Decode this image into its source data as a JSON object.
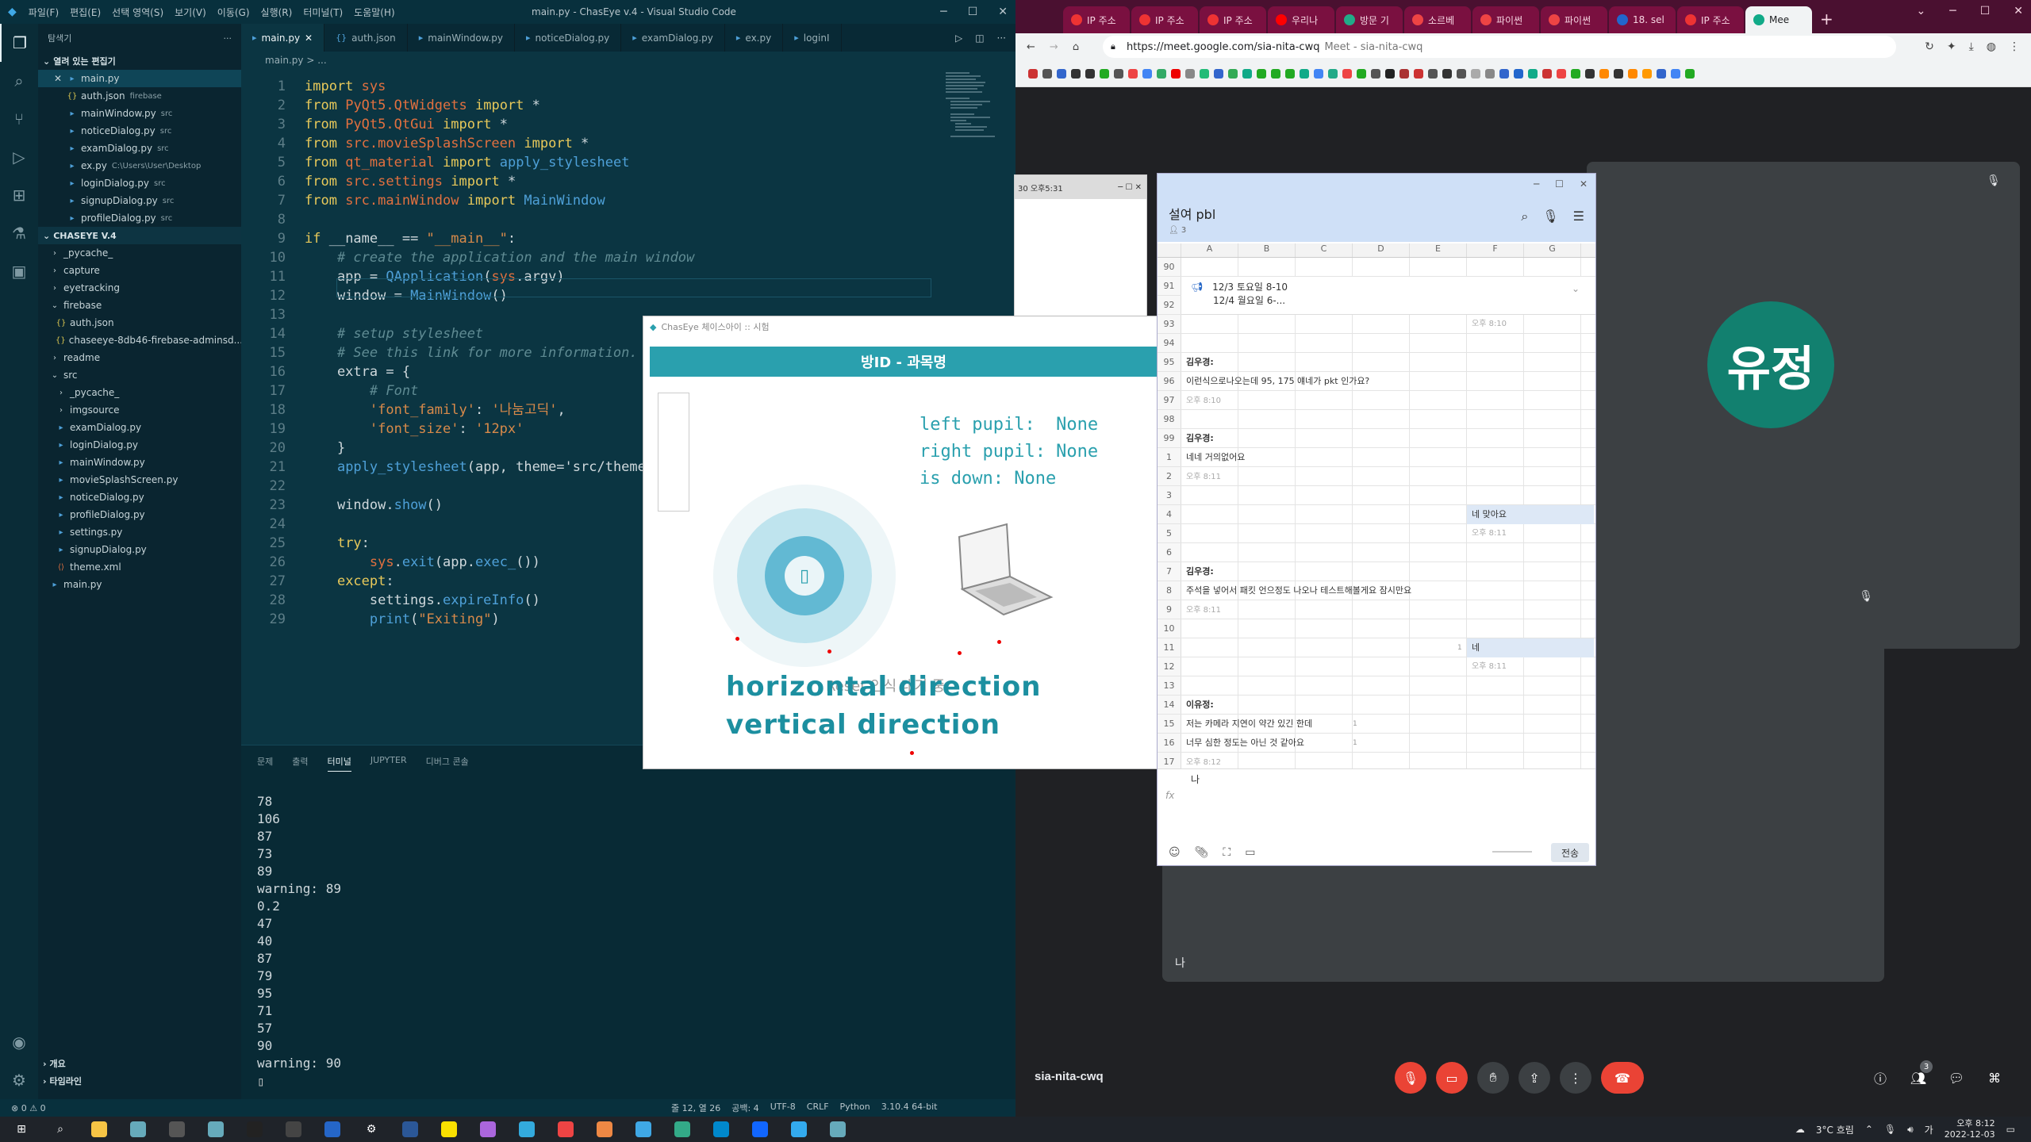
{
  "vscode": {
    "menus": [
      "파일(F)",
      "편집(E)",
      "선택 영역(S)",
      "보기(V)",
      "이동(G)",
      "실행(R)",
      "터미널(T)",
      "도움말(H)"
    ],
    "title": "main.py - ChasEye v.4 - Visual Studio Code",
    "explorer_title": "탐색기",
    "open_editors_label": "열려 있는 편집기",
    "open_editors": [
      {
        "name": "main.py",
        "sub": ""
      },
      {
        "name": "auth.json",
        "sub": "firebase"
      },
      {
        "name": "mainWindow.py",
        "sub": "src"
      },
      {
        "name": "noticeDialog.py",
        "sub": "src"
      },
      {
        "name": "examDialog.py",
        "sub": "src"
      },
      {
        "name": "ex.py",
        "sub": "C:\\Users\\User\\Desktop"
      },
      {
        "name": "loginDialog.py",
        "sub": "src"
      },
      {
        "name": "signupDialog.py",
        "sub": "src"
      },
      {
        "name": "profileDialog.py",
        "sub": "src"
      }
    ],
    "project_label": "CHASEYE V.4",
    "tree": [
      {
        "name": "_pycache_",
        "indent": 1,
        "type": "folder"
      },
      {
        "name": "capture",
        "indent": 1,
        "type": "folder"
      },
      {
        "name": "eyetracking",
        "indent": 1,
        "type": "folder"
      },
      {
        "name": "firebase",
        "indent": 1,
        "type": "folder-open"
      },
      {
        "name": "auth.json",
        "indent": 2,
        "type": "json"
      },
      {
        "name": "chaseeye-8db46-firebase-adminsd...",
        "indent": 2,
        "type": "json"
      },
      {
        "name": "readme",
        "indent": 1,
        "type": "folder"
      },
      {
        "name": "src",
        "indent": 1,
        "type": "folder-open"
      },
      {
        "name": "_pycache_",
        "indent": 2,
        "type": "folder"
      },
      {
        "name": "imgsource",
        "indent": 2,
        "type": "folder"
      },
      {
        "name": "examDialog.py",
        "indent": 2,
        "type": "py"
      },
      {
        "name": "loginDialog.py",
        "indent": 2,
        "type": "py"
      },
      {
        "name": "mainWindow.py",
        "indent": 2,
        "type": "py"
      },
      {
        "name": "movieSplashScreen.py",
        "indent": 2,
        "type": "py"
      },
      {
        "name": "noticeDialog.py",
        "indent": 2,
        "type": "py"
      },
      {
        "name": "profileDialog.py",
        "indent": 2,
        "type": "py"
      },
      {
        "name": "settings.py",
        "indent": 2,
        "type": "py"
      },
      {
        "name": "signupDialog.py",
        "indent": 2,
        "type": "py"
      },
      {
        "name": "theme.xml",
        "indent": 2,
        "type": "xml"
      },
      {
        "name": "main.py",
        "indent": 1,
        "type": "py"
      }
    ],
    "outline_label": "개요",
    "timeline_label": "타임라인",
    "tabs": [
      "main.py",
      "auth.json",
      "mainWindow.py",
      "noticeDialog.py",
      "examDialog.py",
      "ex.py",
      "loginI"
    ],
    "breadcrumb": "main.py > ...",
    "code_lines": [
      "import sys",
      "from PyQt5.QtWidgets import *",
      "from PyQt5.QtGui import *",
      "from src.movieSplashScreen import *",
      "from qt_material import apply_stylesheet",
      "from src.settings import *",
      "from src.mainWindow import MainWindow",
      "",
      "if __name__ == \"__main__\":",
      "    # create the application and the main window",
      "    app = QApplication(sys.argv)",
      "    window = MainWindow()",
      "",
      "    # setup stylesheet",
      "    # See this link for more information.",
      "    extra = {",
      "        # Font",
      "        'font_family': '나눔고딕',",
      "        'font_size': '12px'",
      "    }",
      "    apply_stylesheet(app, theme='src/theme.",
      "",
      "    window.show()",
      "",
      "    try:",
      "        sys.exit(app.exec_())",
      "    except:",
      "        settings.expireInfo()",
      "        print(\"Exiting\")"
    ],
    "panel_tabs": [
      "문제",
      "출력",
      "터미널",
      "JUPYTER",
      "디버그 콘솔"
    ],
    "terminal_lines": [
      "78",
      "106",
      "87",
      "73",
      "89",
      "warning: 89",
      "0.2",
      "47",
      "40",
      "87",
      "79",
      "95",
      "71",
      "57",
      "90",
      "warning: 90"
    ],
    "status_left": "⊗ 0 ⚠ 0",
    "status_right": [
      "줄 12, 열 26",
      "공백: 4",
      "UTF-8",
      "CRLF",
      "Python",
      "3.10.4 64-bit"
    ]
  },
  "browser": {
    "tabs": [
      "IP 주소",
      "IP 주소",
      "IP 주소",
      "우리나",
      "방문 기",
      "소르베",
      "파이썬",
      "파이썬",
      "18. sel",
      "IP 주소",
      "Mee"
    ],
    "url": "https://meet.google.com/sia-nita-cwq",
    "url_title": "Meet - sia-nita-cwq"
  },
  "meet": {
    "meeting_id": "sia-nita-cwq",
    "avatar_text": "유정",
    "participants_badge": "3",
    "tile_caption": "나"
  },
  "small_dialog_title": "30 오후5:31",
  "chaseye": {
    "title": "ChasEye 체이스아이 :: 시험",
    "header": "방ID - 과목명",
    "pupil_text": "left pupil:  None\nright pupil: None\nis down: None",
    "direction_h": "horizontal direction",
    "direction_v": "vertical direction",
    "overlay_text": "Reset 인식 대기 중"
  },
  "chat": {
    "title": "설여 pbl",
    "member_count": "3",
    "columns": [
      "A",
      "B",
      "C",
      "D",
      "E",
      "F",
      "G"
    ],
    "notice_line1": "12/3 토요일 8-10",
    "notice_line2": "12/4 월요일 6-...",
    "rows": [
      {
        "n": "90",
        "t": ""
      },
      {
        "n": "91",
        "t": ""
      },
      {
        "n": "92",
        "t": ""
      },
      {
        "n": "93",
        "t": "",
        "right_time": "오후 8:10"
      },
      {
        "n": "94",
        "t": ""
      },
      {
        "n": "95",
        "t": "김우경:",
        "bold": true
      },
      {
        "n": "96",
        "t": "이런식으로나오는데 95, 175 얘네가 pkt 인가요?"
      },
      {
        "n": "97",
        "t": "오후 8:10",
        "time": true
      },
      {
        "n": "98",
        "t": ""
      },
      {
        "n": "99",
        "t": "김우경:",
        "bold": true
      },
      {
        "n": "1",
        "t": "네네 거의없어요"
      },
      {
        "n": "2",
        "t": "오후 8:11",
        "time": true
      },
      {
        "n": "3",
        "t": ""
      },
      {
        "n": "4",
        "t": "",
        "right": "네 맞아요"
      },
      {
        "n": "5",
        "t": "",
        "right_time": "오후 8:11"
      },
      {
        "n": "6",
        "t": ""
      },
      {
        "n": "7",
        "t": "김우경:",
        "bold": true
      },
      {
        "n": "8",
        "t": "주석을 넣어서 패킷 언으정도 나오나 테스트해볼게요 잠시만요"
      },
      {
        "n": "9",
        "t": "오후 8:11",
        "time": true
      },
      {
        "n": "10",
        "t": ""
      },
      {
        "n": "11",
        "t": "",
        "right": "네",
        "one": "1"
      },
      {
        "n": "12",
        "t": "",
        "right_time": "오후 8:11"
      },
      {
        "n": "13",
        "t": ""
      },
      {
        "n": "14",
        "t": "이유정:",
        "bold": true
      },
      {
        "n": "15",
        "t": "저는 카메라 지연이 약간 있긴 한데",
        "one": "1"
      },
      {
        "n": "16",
        "t": "너무 심한 정도는 아닌 것 같아요",
        "one": "1"
      },
      {
        "n": "17",
        "t": "오후 8:12",
        "time": true
      }
    ],
    "input_text": "나",
    "send_label": "전송"
  },
  "taskbar": {
    "weather": "3°C 흐림",
    "ime": "가",
    "time": "오후 8:12",
    "date": "2022-12-03"
  }
}
